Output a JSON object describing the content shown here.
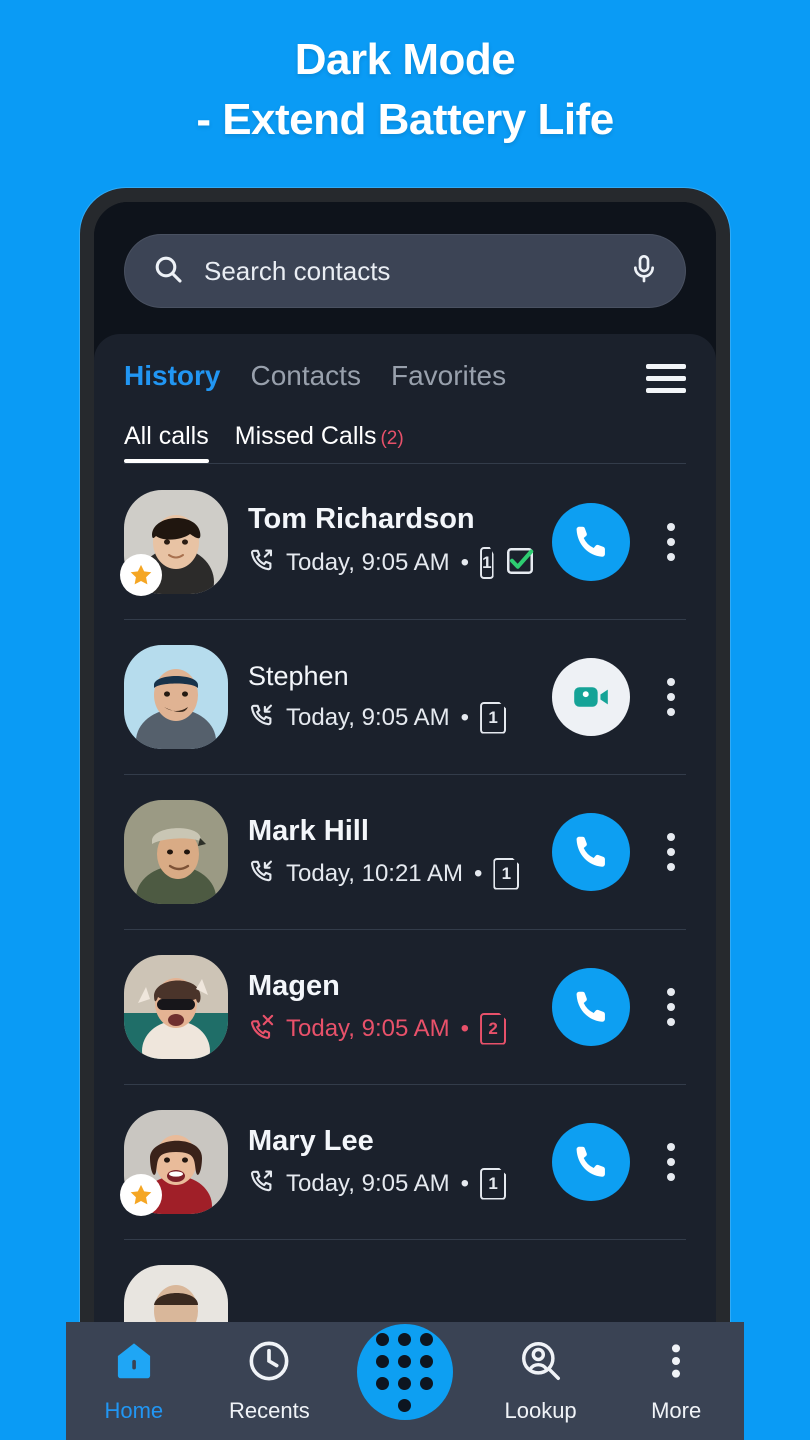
{
  "promo": {
    "line1": "Dark Mode",
    "line2": "- Extend Battery Life"
  },
  "colors": {
    "background": "#0a9bf5",
    "accent": "#0d9ff2",
    "tab_active": "#2196f3",
    "missed": "#e8516a",
    "video": "#15a397",
    "star": "#f5a623",
    "check": "#2ecc71",
    "screen": "#0e131b",
    "panel": "#1b212c",
    "navbar": "#3a4354"
  },
  "search": {
    "placeholder": "Search contacts",
    "search_icon": "search-icon",
    "mic_icon": "microphone-icon"
  },
  "tabs": {
    "menu_icon": "hamburger-menu-icon",
    "items": [
      {
        "label": "History",
        "active": true
      },
      {
        "label": "Contacts",
        "active": false
      },
      {
        "label": "Favorites",
        "active": false
      }
    ],
    "subtabs": [
      {
        "label": "All calls",
        "active": true,
        "count": ""
      },
      {
        "label": "Missed Calls",
        "active": false,
        "count": "(2)"
      }
    ]
  },
  "calls": [
    {
      "name": "Tom Richardson",
      "time": "Today, 9:05 AM",
      "separator": "•",
      "sim": "1",
      "direction": "outgoing",
      "direction_icon": "outgoing-call-icon",
      "missed": false,
      "favorite": true,
      "verified": true,
      "action": "call",
      "action_icon": "phone-icon",
      "menu_icon": "more-vertical-icon"
    },
    {
      "name": "Stephen",
      "time": "Today, 9:05 AM",
      "separator": "•",
      "sim": "1",
      "direction": "incoming",
      "direction_icon": "incoming-call-icon",
      "missed": false,
      "favorite": false,
      "verified": false,
      "action": "video",
      "action_icon": "video-camera-icon",
      "menu_icon": "more-vertical-icon"
    },
    {
      "name": "Mark Hill",
      "time": "Today, 10:21 AM",
      "separator": "•",
      "sim": "1",
      "direction": "incoming",
      "direction_icon": "incoming-call-icon",
      "missed": false,
      "favorite": false,
      "verified": false,
      "action": "call",
      "action_icon": "phone-icon",
      "menu_icon": "more-vertical-icon"
    },
    {
      "name": "Magen",
      "time": "Today, 9:05 AM",
      "separator": "•",
      "sim": "2",
      "direction": "missed",
      "direction_icon": "missed-call-icon",
      "missed": true,
      "favorite": false,
      "verified": false,
      "action": "call",
      "action_icon": "phone-icon",
      "menu_icon": "more-vertical-icon"
    },
    {
      "name": "Mary Lee",
      "time": "Today, 9:05 AM",
      "separator": "•",
      "sim": "1",
      "direction": "outgoing",
      "direction_icon": "outgoing-call-icon",
      "missed": false,
      "favorite": true,
      "verified": false,
      "action": "call",
      "action_icon": "phone-icon",
      "menu_icon": "more-vertical-icon"
    }
  ],
  "bottom_nav": [
    {
      "label": "Home",
      "icon": "home-icon",
      "active": true
    },
    {
      "label": "Recents",
      "icon": "clock-icon",
      "active": false
    },
    {
      "label": "",
      "icon": "dialpad-icon",
      "active": false,
      "fab": true
    },
    {
      "label": "Lookup",
      "icon": "person-search-icon",
      "active": false
    },
    {
      "label": "More",
      "icon": "more-vertical-icon",
      "active": false
    }
  ]
}
